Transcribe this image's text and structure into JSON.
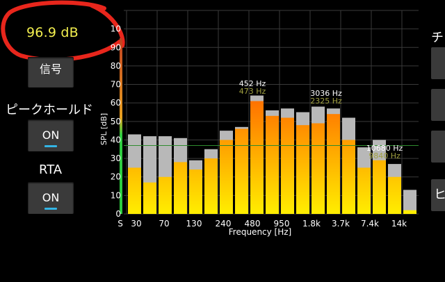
{
  "level_readout": "96.9 dB",
  "buttons": {
    "signal_label": "信号",
    "peak_hold_label": "ピークホールド",
    "peak_hold_value": "ON",
    "rta_label": "RTA",
    "rta_value": "ON"
  },
  "right_panel": {
    "header_glyph": "チ",
    "bottom_glyph": "ヒ"
  },
  "chart_data": {
    "type": "bar",
    "xlabel": "Frequency [Hz]",
    "ylabel": "SPL [dB]",
    "ylim": [
      0,
      110
    ],
    "y_ticks": [
      "0",
      "10",
      "20",
      "30",
      "40",
      "50",
      "60",
      "70",
      "80",
      "90",
      "10"
    ],
    "x_tick_labels": [
      "S",
      "30",
      "70",
      "130",
      "240",
      "480",
      "950",
      "1.8k",
      "3.7k",
      "7.4k",
      "14k"
    ],
    "series": [
      {
        "values": [
          25,
          17,
          20,
          28,
          24,
          30,
          40,
          46,
          61,
          53,
          52,
          48,
          49,
          54,
          40,
          25,
          29,
          20,
          2
        ]
      },
      {
        "values": [
          43,
          42,
          42,
          41,
          29,
          35,
          45,
          47,
          64,
          56,
          57,
          55,
          58,
          57,
          52,
          36,
          40,
          27,
          13
        ]
      }
    ],
    "reference_level": 37,
    "annotations": [
      {
        "top": "452 Hz",
        "bottom": "473 Hz"
      },
      {
        "top": "3036 Hz",
        "bottom": "2325 Hz"
      },
      {
        "top": "10680 Hz",
        "bottom": "9840 Hz"
      }
    ],
    "colors": {
      "bar_low": "#ffee00",
      "bar_high": "#ff6a00",
      "peak": "#b8b8b8",
      "grid": "#3a3a3a",
      "ref_line": "#2e8b2e",
      "annot_top": "#ffffff",
      "annot_bottom": "#a0a040"
    }
  }
}
